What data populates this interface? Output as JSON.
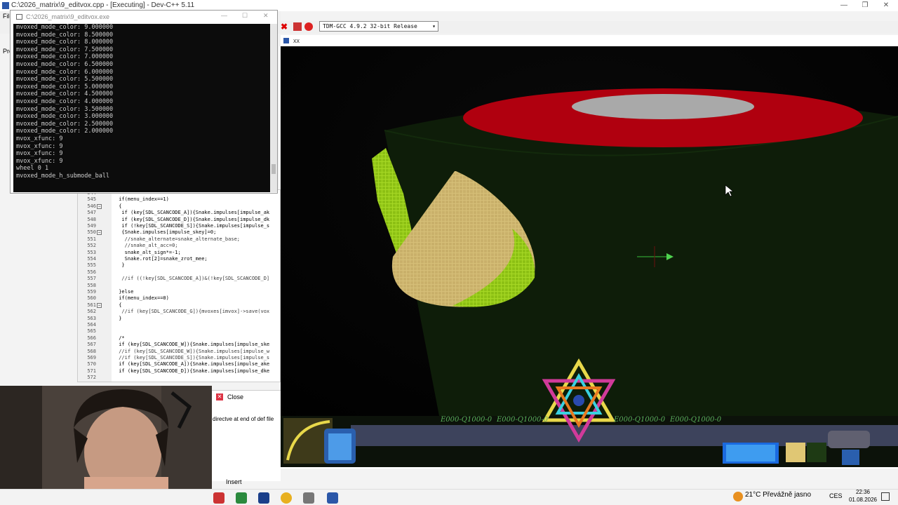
{
  "devcpp": {
    "title": "C:\\2026_matrix\\9_editvox.cpp - [Executing] - Dev-C++ 5.11",
    "menu_items": [
      "File",
      "Pro"
    ],
    "compiler": "TDM-GCC 4.9.2 32-bit Release"
  },
  "console": {
    "title": "C:\\2026_matrix\\9_editvox.exe",
    "lines": [
      "mvoxed_mode_color: 9.000000",
      "mvoxed_mode_color: 8.500000",
      "mvoxed_mode_color: 8.000000",
      "mvoxed_mode_color: 7.500000",
      "mvoxed_mode_color: 7.000000",
      "mvoxed_mode_color: 6.500000",
      "mvoxed_mode_color: 6.000000",
      "mvoxed_mode_color: 5.500000",
      "mvoxed_mode_color: 5.000000",
      "mvoxed_mode_color: 4.500000",
      "mvoxed_mode_color: 4.000000",
      "mvoxed_mode_color: 3.500000",
      "mvoxed_mode_color: 3.000000",
      "mvoxed_mode_color: 2.500000",
      "mvoxed_mode_color: 2.000000",
      "mvox_xfunc: 9",
      "mvox_xfunc: 9",
      "mvox_xfunc: 9",
      "mvox_xfunc: 9",
      "wheel 0 1",
      "mvoxed_mode_h_submode_ball"
    ]
  },
  "editor": {
    "lines": [
      {
        "n": "544",
        "t": ""
      },
      {
        "n": "545",
        "t": " if(menu_index==1)"
      },
      {
        "n": "546",
        "t": " {"
      },
      {
        "n": "547",
        "t": "  if (key[SDL_SCANCODE_A]){Snake.impulses[impulse_ak"
      },
      {
        "n": "548",
        "t": "  if (key[SDL_SCANCODE_D]){Snake.impulses[impulse_dk"
      },
      {
        "n": "549",
        "t": "  if (!key[SDL_SCANCODE_S]){Snake.impulses[impulse_s"
      },
      {
        "n": "550",
        "t": "  {Snake.impulses[impulse_skey]=0;"
      },
      {
        "n": "551",
        "t": "   //snake_alternate=snake_alternate_base;"
      },
      {
        "n": "552",
        "t": "   //snake_alt_acc=0;"
      },
      {
        "n": "553",
        "t": "   snake_alt_sign*=-1;"
      },
      {
        "n": "554",
        "t": "   Snake.rot[2]=snake_zrot_mee;"
      },
      {
        "n": "555",
        "t": "  }"
      },
      {
        "n": "556",
        "t": ""
      },
      {
        "n": "557",
        "t": "  //if ((!key[SDL_SCANCODE_A])&(!key[SDL_SCANCODE_D]"
      },
      {
        "n": "558",
        "t": ""
      },
      {
        "n": "559",
        "t": " }else"
      },
      {
        "n": "560",
        "t": " if(menu_index==0)"
      },
      {
        "n": "561",
        "t": " {"
      },
      {
        "n": "562",
        "t": "  //if (key[SDL_SCANCODE_G]){mvoxes[imvox]->save(vox"
      },
      {
        "n": "563",
        "t": " }"
      },
      {
        "n": "564",
        "t": ""
      },
      {
        "n": "565",
        "t": ""
      },
      {
        "n": "566",
        "t": " /*"
      },
      {
        "n": "567",
        "t": " if (key[SDL_SCANCODE_W]){Snake.impulses[impulse_ske"
      },
      {
        "n": "568",
        "t": " //if (key[SDL_SCANCODE_W]){Snake.impulses[impulse_w"
      },
      {
        "n": "569",
        "t": " //if (key[SDL_SCANCODE_S]){Snake.impulses[impulse_s"
      },
      {
        "n": "570",
        "t": " if (key[SDL_SCANCODE_A]){Snake.impulses[impulse_ake"
      },
      {
        "n": "571",
        "t": " if (key[SDL_SCANCODE_D]){Snake.impulses[impulse_dke"
      },
      {
        "n": "572",
        "t": ""
      }
    ]
  },
  "game": {
    "title": "xx",
    "hud_texts": [
      "E000-Q1000-0",
      "E000-Q1000-0",
      "E000-Q1000-0",
      "E000-Q1000-0"
    ]
  },
  "bottom_panel": {
    "close_label": "Close",
    "message": "directve at end of def file",
    "insert_label": "Insert"
  },
  "taskbar": {
    "weather": "21°C  Převážně jasno",
    "language": "CES",
    "time": "22:36",
    "date": "01.08.2026"
  },
  "colors": {
    "console_bg": "#0c0c0c",
    "console_text": "#cfcfcf",
    "ground_green": "#0f1f0a",
    "red_ring": "#b00010",
    "voxel_tan": "#d9c27a",
    "voxel_lime": "#9ad21a"
  }
}
